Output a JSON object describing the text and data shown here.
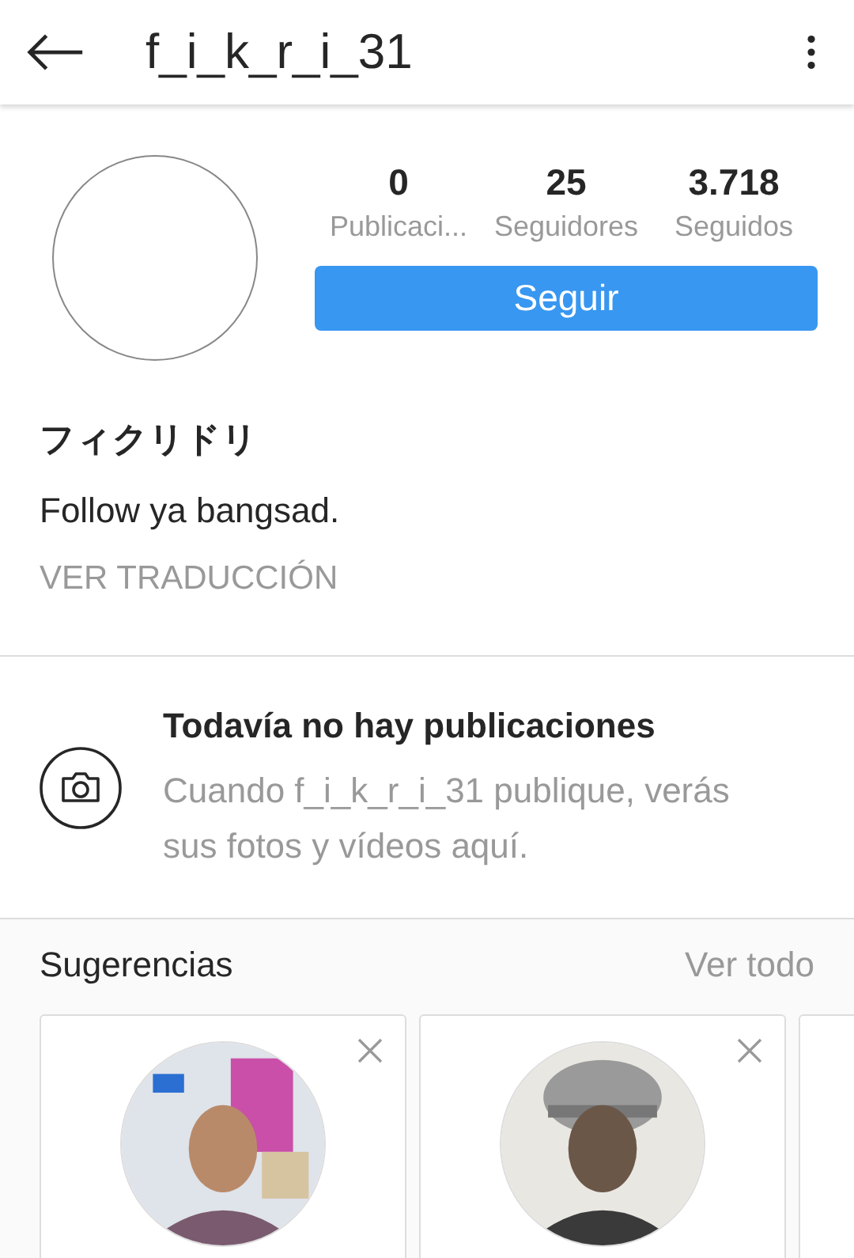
{
  "header": {
    "title": "f_i_k_r_i_31"
  },
  "stats": [
    {
      "value": "0",
      "label": "Publicaci..."
    },
    {
      "value": "25",
      "label": "Seguidores"
    },
    {
      "value": "3.718",
      "label": "Seguidos"
    }
  ],
  "follow_button": "Seguir",
  "profile": {
    "name": "フィクリドリ",
    "bio": "Follow ya bangsad.",
    "translate_link": "VER TRADUCCIÓN"
  },
  "empty_state": {
    "title": "Todavía no hay publicaciones",
    "text": "Cuando f_i_k_r_i_31 publique, verás sus fotos y vídeos aquí."
  },
  "suggestions": {
    "title": "Sugerencias",
    "see_all": "Ver todo",
    "cards": [
      {
        "kind": "picture"
      },
      {
        "kind": "picture"
      },
      {
        "kind": "blank"
      }
    ]
  }
}
